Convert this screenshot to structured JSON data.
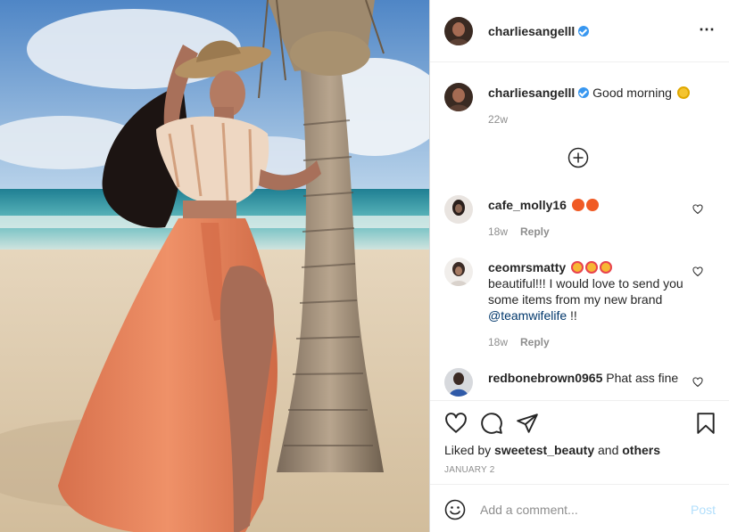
{
  "post": {
    "username": "charliesangelll",
    "verified": true,
    "more_icon": "⋯"
  },
  "caption": {
    "username": "charliesangelll",
    "text": "Good morning",
    "emoji": "sun-emoji",
    "age": "22w"
  },
  "comments": [
    {
      "username": "cafe_molly16",
      "text": "",
      "emojis": [
        "fire-emoji",
        "fire-emoji"
      ],
      "age": "18w",
      "reply_label": "Reply"
    },
    {
      "username": "ceomrsmatty",
      "emojis": [
        "star-struck-emoji",
        "star-struck-emoji",
        "star-struck-emoji"
      ],
      "text_before": "beautiful!!! I would love to send you some items from my new brand ",
      "mention": "@teamwifelife",
      "text_after": " !!",
      "age": "18w",
      "reply_label": "Reply"
    },
    {
      "username": "redbonebrown0965",
      "text": "Phat ass fine"
    }
  ],
  "likes": {
    "prefix": "Liked by ",
    "user": "sweetest_beauty",
    "middle": " and ",
    "others": "others"
  },
  "date": "JANUARY 2",
  "comment_box": {
    "placeholder": "Add a comment...",
    "post_label": "Post"
  },
  "colors": {
    "verified": "#3897f0",
    "mention": "#00376b",
    "muted": "#8e8e8e",
    "post_button": "#b2dffc",
    "skirt": "#e8845f"
  }
}
